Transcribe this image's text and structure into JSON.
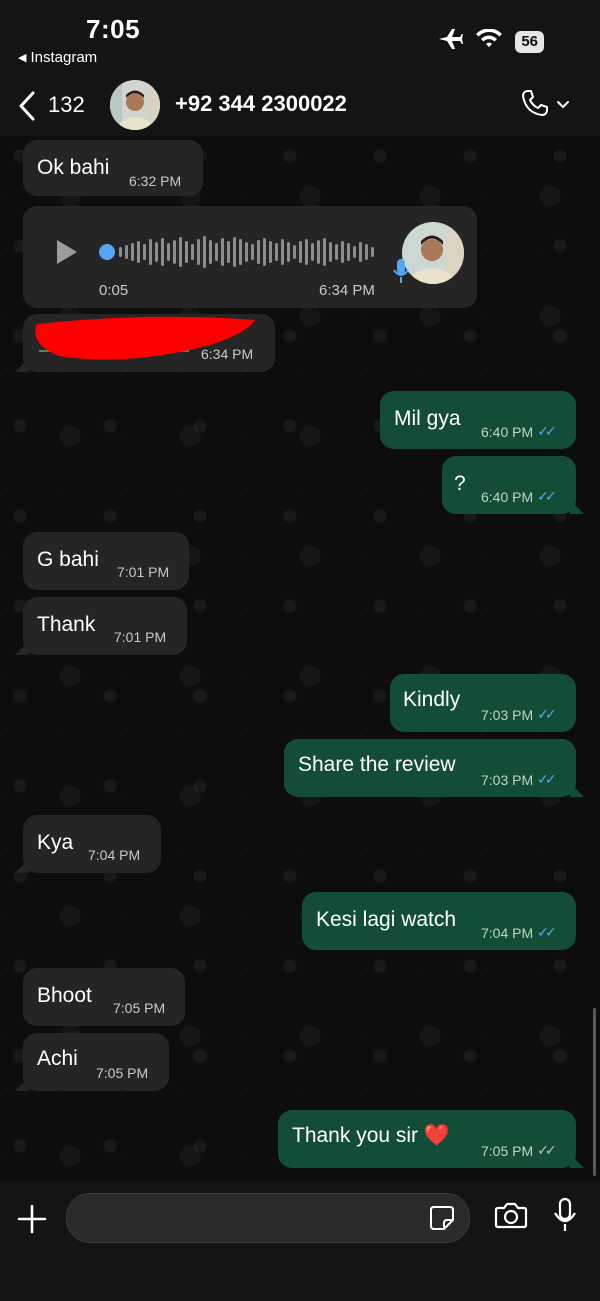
{
  "status_bar": {
    "time": "7:05",
    "back_app": "Instagram",
    "battery": "56"
  },
  "header": {
    "unread_count": "132",
    "contact_name": "+92 344 2300022"
  },
  "messages": [
    {
      "dir": "in",
      "text": "Ok bahi",
      "time": "6:32 PM"
    },
    {
      "dir": "in",
      "type": "voice",
      "duration": "0:05",
      "time": "6:34 PM"
    },
    {
      "dir": "in",
      "type": "redacted",
      "text": "",
      "time": "6:34 PM"
    },
    {
      "dir": "out",
      "text": "Mil gya",
      "time": "6:40 PM",
      "status": "read"
    },
    {
      "dir": "out",
      "text": "?",
      "time": "6:40 PM",
      "status": "read"
    },
    {
      "dir": "in",
      "text": "G bahi",
      "time": "7:01 PM"
    },
    {
      "dir": "in",
      "text": "Thank",
      "time": "7:01 PM"
    },
    {
      "dir": "out",
      "text": "Kindly",
      "time": "7:03 PM",
      "status": "read"
    },
    {
      "dir": "out",
      "text": "Share the review",
      "time": "7:03 PM",
      "status": "read"
    },
    {
      "dir": "in",
      "text": "Kya",
      "time": "7:04 PM"
    },
    {
      "dir": "out",
      "text": "Kesi lagi watch",
      "time": "7:04 PM",
      "status": "read"
    },
    {
      "dir": "in",
      "text": "Bhoot",
      "time": "7:05 PM"
    },
    {
      "dir": "in",
      "text": "Achi",
      "time": "7:05 PM"
    },
    {
      "dir": "out",
      "text": "Thank you sir ❤️",
      "time": "7:05 PM",
      "status": "delivered"
    }
  ],
  "composer": {
    "value": "",
    "placeholder": ""
  },
  "icons": {
    "back": "chevron-left-icon",
    "call": "phone-icon",
    "dropdown": "chevron-down-icon",
    "plus": "plus-icon",
    "sticker": "sticker-icon",
    "camera": "camera-icon",
    "mic": "microphone-icon",
    "play": "play-icon",
    "read_ticks": "double-check-icon"
  },
  "colors": {
    "incoming_bubble": "#252525",
    "outgoing_bubble": "#144d37",
    "read_ticks": "#53a7f0",
    "voice_dot": "#53a7f0",
    "redaction": "#ff0000"
  }
}
